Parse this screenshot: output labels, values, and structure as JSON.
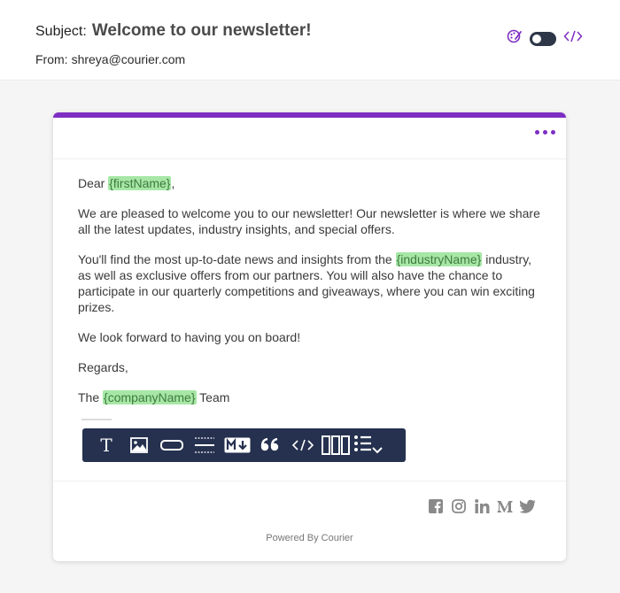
{
  "header": {
    "subject_label": "Subject:",
    "subject_value": "Welcome to our newsletter!",
    "from_label": "From:",
    "from_value": "shreya@courier.com",
    "icons": [
      "palette-icon",
      "toggle-switch",
      "code-icon"
    ],
    "accent_color": "#7e2ec2"
  },
  "email": {
    "greeting_prefix": "Dear ",
    "greeting_var": "{firstName}",
    "greeting_suffix": ",",
    "para1": "We are pleased to welcome you to our newsletter! Our newsletter is where we share all the latest updates, industry insights, and special offers.",
    "para2_prefix": "You'll find the most up-to-date news and insights from the ",
    "para2_var": "{industryName}",
    "para2_suffix": " industry, as well as exclusive offers from our partners. You will also have the chance to participate in our quarterly competitions and giveaways, where you can win exciting prizes.",
    "para3": "We look forward to having you on board!",
    "regards": "Regards,",
    "signoff_prefix": "The ",
    "signoff_var": "{companyName}",
    "signoff_suffix": " Team"
  },
  "toolbar": {
    "items": [
      "text-block",
      "image-block",
      "action-button-block",
      "divider-block",
      "markdown-block",
      "quote-block",
      "code-block",
      "columns-block",
      "list-block"
    ]
  },
  "footer": {
    "social": [
      "facebook-icon",
      "instagram-icon",
      "linkedin-icon",
      "medium-icon",
      "twitter-icon"
    ],
    "powered_by": "Powered By Courier"
  }
}
